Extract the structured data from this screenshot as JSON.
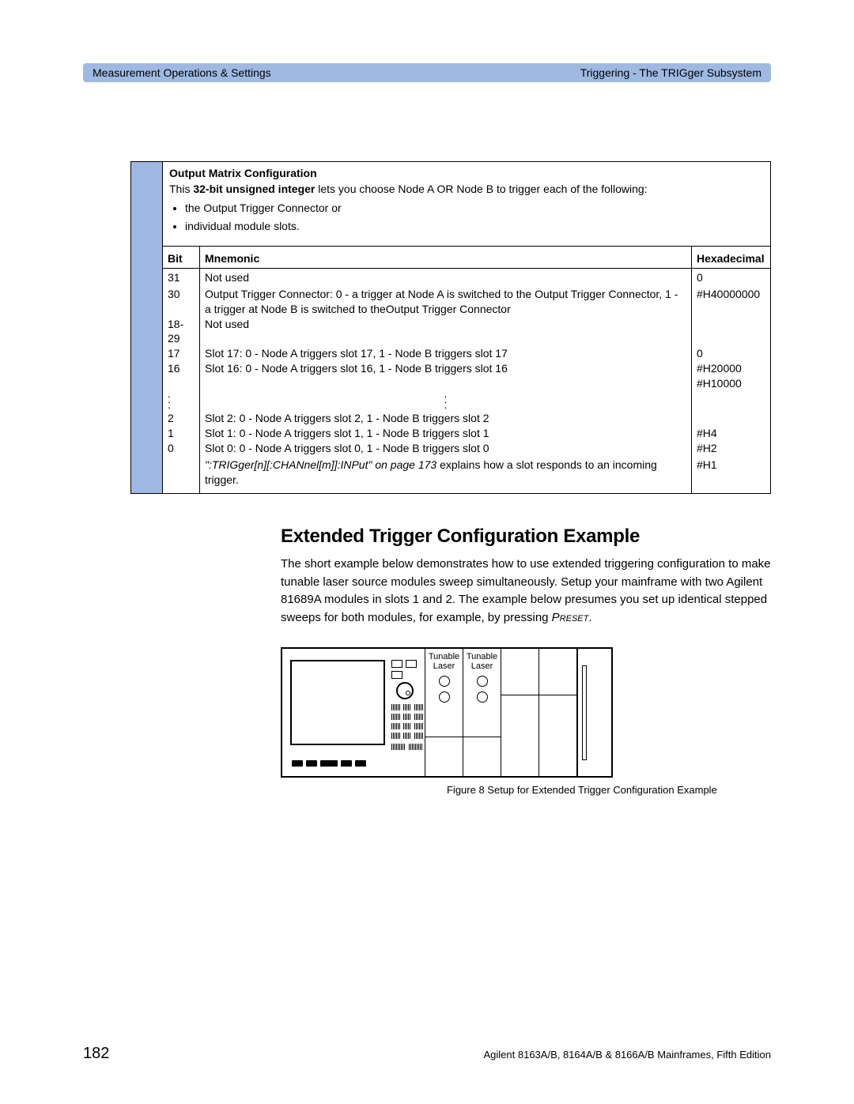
{
  "header": {
    "left": "Measurement Operations & Settings",
    "right": "Triggering - The TRIGger Subsystem"
  },
  "intro": {
    "title": "Output Matrix Configuration",
    "lead_pre": "This ",
    "lead_bold": "32-bit unsigned integer",
    "lead_post": " lets you choose Node A OR Node B to trigger each of the following:",
    "bullets": [
      "the Output Trigger Connector or",
      "individual module slots."
    ]
  },
  "table_headers": {
    "bit": "Bit",
    "mnemonic": "Mnemonic",
    "hex": "Hexadecimal"
  },
  "rows": [
    {
      "bit": "31",
      "mnem": "Not used",
      "hex": "0"
    },
    {
      "bit": "30",
      "mnem": "Output Trigger Connector: 0 - a trigger at Node A is switched to the Output Trigger Connector, 1 - a trigger at Node B is switched to theOutput Trigger Connector",
      "hex": "#H40000000"
    },
    {
      "bit": "18-29",
      "mnem": "Not used",
      "hex": ""
    },
    {
      "bit": "17",
      "mnem": "Slot 17: 0 - Node A triggers slot 17, 1 - Node B triggers slot 17",
      "hex": "0"
    },
    {
      "bit": "16",
      "mnem": "Slot 16: 0 - Node A triggers slot 16, 1 - Node B triggers slot 16",
      "hex": "#H20000"
    },
    {
      "bit": "",
      "mnem": "",
      "hex": "#H10000"
    },
    {
      "bit": "2",
      "mnem": "Slot 2: 0 - Node A triggers slot 2, 1 - Node B triggers slot 2",
      "hex": ""
    },
    {
      "bit": "1",
      "mnem": "Slot 1: 0 - Node A triggers slot 1, 1 - Node B triggers slot 1",
      "hex": "#H4"
    },
    {
      "bit": "0",
      "mnem": "Slot 0: 0 - Node A triggers slot 0, 1 - Node B triggers slot 0",
      "hex": "#H2"
    },
    {
      "bit": "",
      "mnem_ital": "\":TRIGger[n][:CHANnel[m]]:INPut\" on page 173",
      "mnem_post": " explains how a slot responds to an incoming trigger.",
      "hex": "#H1"
    }
  ],
  "section": {
    "heading": "Extended Trigger Configuration Example",
    "body_pre": "The short example below demonstrates how to use extended triggering configuration to make tunable laser source modules sweep simultaneously. Setup your mainframe with two Agilent 81689A modules in slots 1 and 2. The example below presumes you set up identical stepped sweeps for both modules, for example, by pressing ",
    "body_sc": "Preset",
    "body_post": "."
  },
  "figure": {
    "slot_label_1": "Tunable Laser",
    "slot_label_2": "Tunable Laser",
    "caption": "Figure 8  Setup for Extended Trigger Configuration Example"
  },
  "footer": {
    "page": "182",
    "text": "Agilent 8163A/B, 8164A/B & 8166A/B Mainframes, Fifth Edition"
  }
}
